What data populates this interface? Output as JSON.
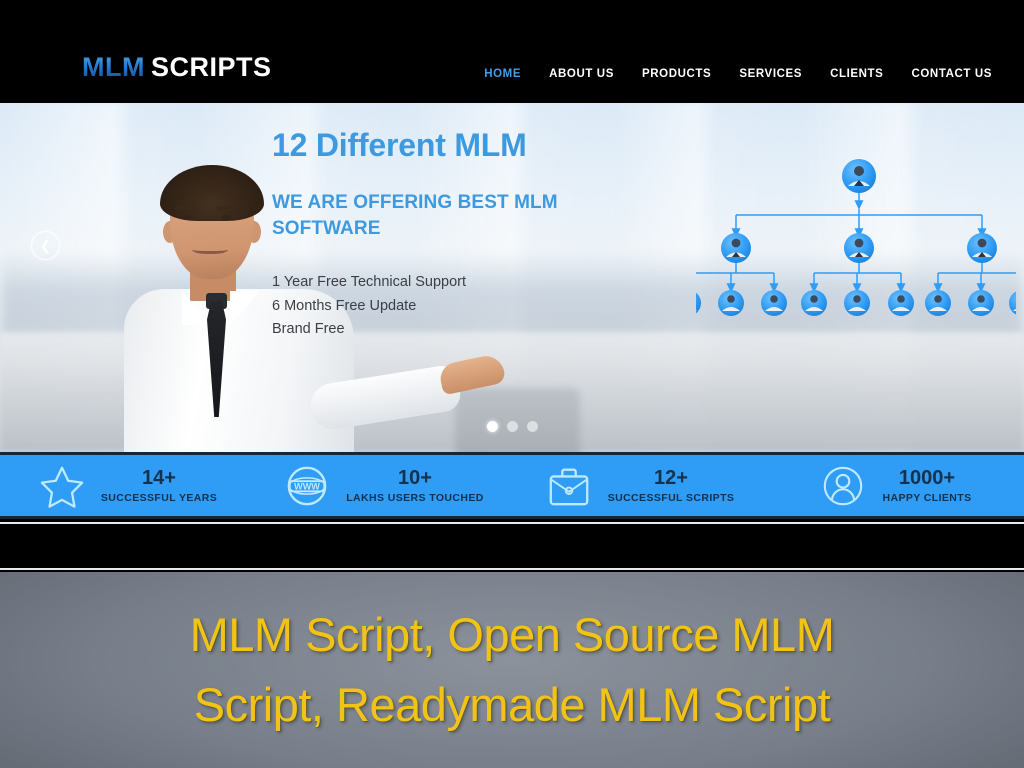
{
  "header": {
    "logo": {
      "primary": "MLM",
      "secondary": "SCRIPTS",
      "primary_color": "#2f8fdd",
      "secondary_color": "#ffffff"
    },
    "nav": [
      {
        "label": "HOME",
        "active": true
      },
      {
        "label": "ABOUT US",
        "active": false
      },
      {
        "label": "PRODUCTS",
        "active": false
      },
      {
        "label": "SERVICES",
        "active": false
      },
      {
        "label": "CLIENTS",
        "active": false
      },
      {
        "label": "CONTACT US",
        "active": false
      }
    ],
    "background_color": "#000000"
  },
  "hero": {
    "title": "12 Different MLM",
    "subtitle_line1": "WE ARE OFFERING BEST MLM",
    "subtitle_line2": "SOFTWARE",
    "features": [
      "1 Year Free Technical Support",
      "6 Months Free Update",
      "Brand Free"
    ],
    "accent_color": "#3d9ae0",
    "prev_arrow_glyph": "❮",
    "dots": [
      {
        "active": true
      },
      {
        "active": false
      },
      {
        "active": false
      }
    ],
    "diagram": {
      "name": "mlm-network-tree",
      "levels": [
        1,
        3,
        9
      ],
      "node_color": "#2f9cf6",
      "line_color": "#2f9cf6"
    }
  },
  "stats": {
    "background_color": "#2f9cf6",
    "items": [
      {
        "icon": "star-icon",
        "value": "14+",
        "label": "SUCCESSFUL YEARS"
      },
      {
        "icon": "www-globe-icon",
        "value": "10+",
        "label": "LAKHS USERS TOUCHED"
      },
      {
        "icon": "briefcase-icon",
        "value": "12+",
        "label": "SUCCESSFUL SCRIPTS"
      },
      {
        "icon": "person-icon",
        "value": "1000+",
        "label": "HAPPY CLIENTS"
      }
    ]
  },
  "banner": {
    "line1": "MLM Script, Open Source MLM",
    "line2": "Script, Readymade MLM Script",
    "text_color": "#f2c317",
    "background_color": "#777e89"
  }
}
